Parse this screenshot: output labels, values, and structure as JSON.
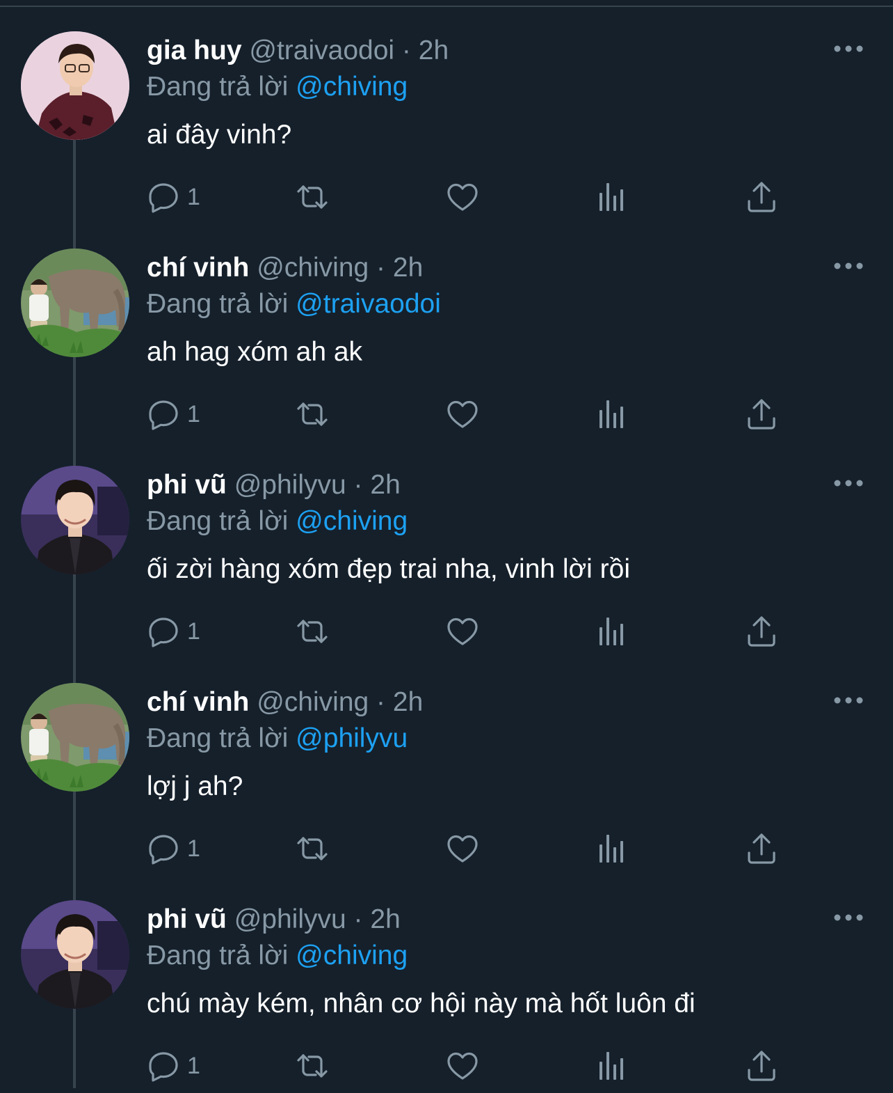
{
  "colors": {
    "background": "#15202b",
    "divider": "#38444d",
    "text": "#ffffff",
    "secondary": "#8899a6",
    "accent": "#1da1f2"
  },
  "separator": "·",
  "reply_prefix": "Đang trả lời",
  "icons": {
    "reply": "speech-bubble-icon",
    "retweet": "retweet-arrows-icon",
    "like": "heart-icon",
    "analytics": "bar-chart-icon",
    "share": "upload-share-icon",
    "more": "ellipsis-icon"
  },
  "tweets": [
    {
      "display_name": "gia huy",
      "handle": "@traivaodoi",
      "time": "2h",
      "reply_to": "@chiving",
      "text": "ai đây vinh?",
      "reply_count": "1",
      "avatar": "man-in-dark-patterned-jacket"
    },
    {
      "display_name": "chí vinh",
      "handle": "@chiving",
      "time": "2h",
      "reply_to": "@traivaodoi",
      "text": "ah hag xóm ah ak",
      "reply_count": "1",
      "avatar": "person-beside-elephant"
    },
    {
      "display_name": "phi vũ",
      "handle": "@philyvu",
      "time": "2h",
      "reply_to": "@chiving",
      "text": "ối zời hàng xóm đẹp trai nha, vinh lời rồi",
      "reply_count": "1",
      "avatar": "young-man-portrait"
    },
    {
      "display_name": "chí vinh",
      "handle": "@chiving",
      "time": "2h",
      "reply_to": "@philyvu",
      "text": "lợj j ah?",
      "reply_count": "1",
      "avatar": "person-beside-elephant"
    },
    {
      "display_name": "phi vũ",
      "handle": "@philyvu",
      "time": "2h",
      "reply_to": "@chiving",
      "text": "chú mày kém, nhân cơ hội này mà hốt luôn đi",
      "reply_count": "1",
      "avatar": "young-man-portrait"
    }
  ]
}
